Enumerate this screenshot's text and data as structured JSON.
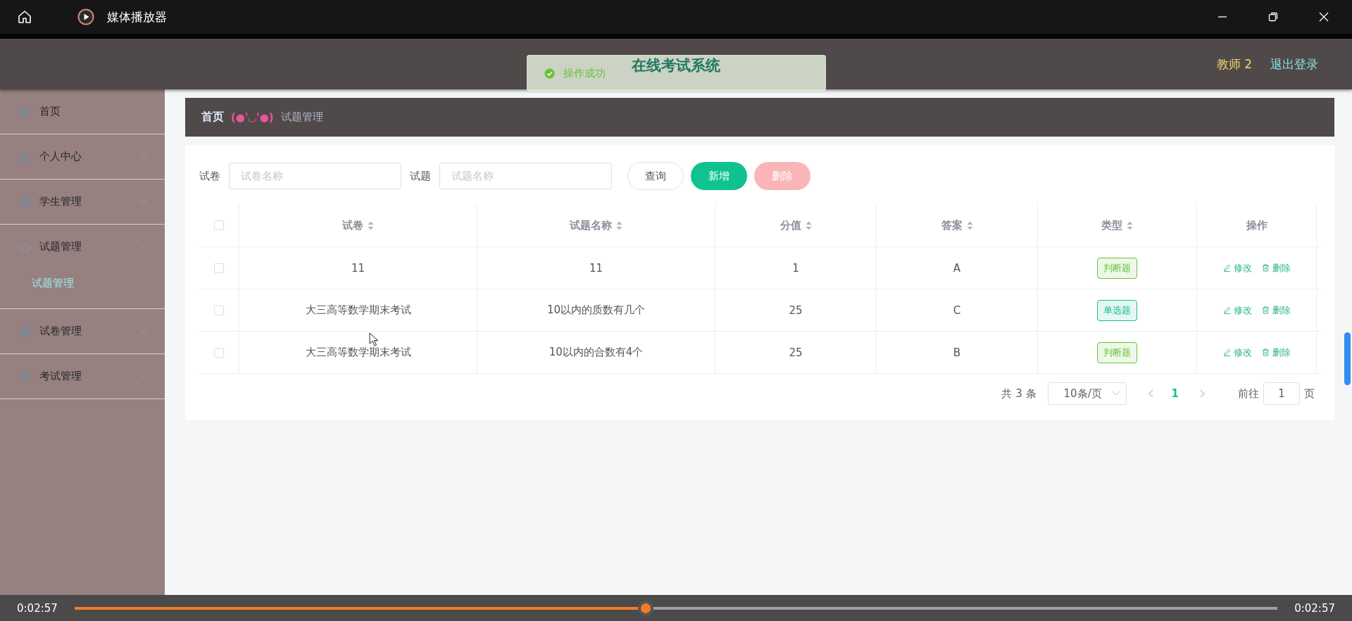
{
  "player": {
    "title": "媒体播放器",
    "elapsed": "0:02:57",
    "total": "0:02:57",
    "level": 0.475
  },
  "header": {
    "title": "在线考试系统",
    "user": "教师 2",
    "logout": "退出登录"
  },
  "toast": {
    "message": "操作成功"
  },
  "sidebar": {
    "items": [
      {
        "label": "首页",
        "kind": "link"
      },
      {
        "label": "个人中心",
        "kind": "menu",
        "expanded": false
      },
      {
        "label": "学生管理",
        "kind": "menu",
        "expanded": false
      },
      {
        "label": "试题管理",
        "kind": "menu",
        "expanded": true,
        "children": [
          {
            "label": "试题管理",
            "selected": true
          }
        ]
      },
      {
        "label": "试卷管理",
        "kind": "menu",
        "expanded": false
      },
      {
        "label": "考试管理",
        "kind": "menu",
        "expanded": false
      }
    ]
  },
  "breadcrumb": {
    "home": "首页",
    "separator": "(●'◡'●)",
    "current": "试题管理"
  },
  "search": {
    "fields": [
      {
        "label": "试卷",
        "placeholder": "试卷名称"
      },
      {
        "label": "试题",
        "placeholder": "试题名称"
      }
    ],
    "buttons": [
      {
        "label": "查询",
        "kind": "outline"
      },
      {
        "label": "新增",
        "kind": "primary"
      },
      {
        "label": "删除",
        "kind": "danger",
        "disabled": true
      }
    ]
  },
  "table": {
    "all_checked": false,
    "columns": [
      {
        "label": "试卷",
        "sortable": true
      },
      {
        "label": "试题名称",
        "sortable": true
      },
      {
        "label": "分值",
        "sortable": true
      },
      {
        "label": "答案",
        "sortable": true
      },
      {
        "label": "类型",
        "sortable": true
      },
      {
        "label": "操作",
        "sortable": false
      }
    ],
    "rows": [
      {
        "checked": false,
        "paper": "11",
        "question": "11",
        "score": "1",
        "answer": "A",
        "type": {
          "label": "判断题",
          "color": "#67c23a"
        },
        "actions": [
          "修改",
          "删除"
        ]
      },
      {
        "checked": false,
        "paper": "大三高等数学期末考试",
        "question": "10以内的质数有几个",
        "score": "25",
        "answer": "C",
        "type": {
          "label": "单选题",
          "color": "#1abc9c"
        },
        "actions": [
          "修改",
          "删除"
        ]
      },
      {
        "checked": false,
        "paper": "大三高等数学期末考试",
        "question": "10以内的合数有4个",
        "score": "25",
        "answer": "B",
        "type": {
          "label": "判断题",
          "color": "#67c23a"
        },
        "actions": [
          "修改",
          "删除"
        ]
      }
    ]
  },
  "pagination": {
    "total": "共 3 条",
    "page_size": "10条/页",
    "pages": [
      {
        "label": "1",
        "selected": true
      }
    ],
    "goto_label": "前往",
    "goto_value": "1",
    "page_suffix": "页"
  }
}
